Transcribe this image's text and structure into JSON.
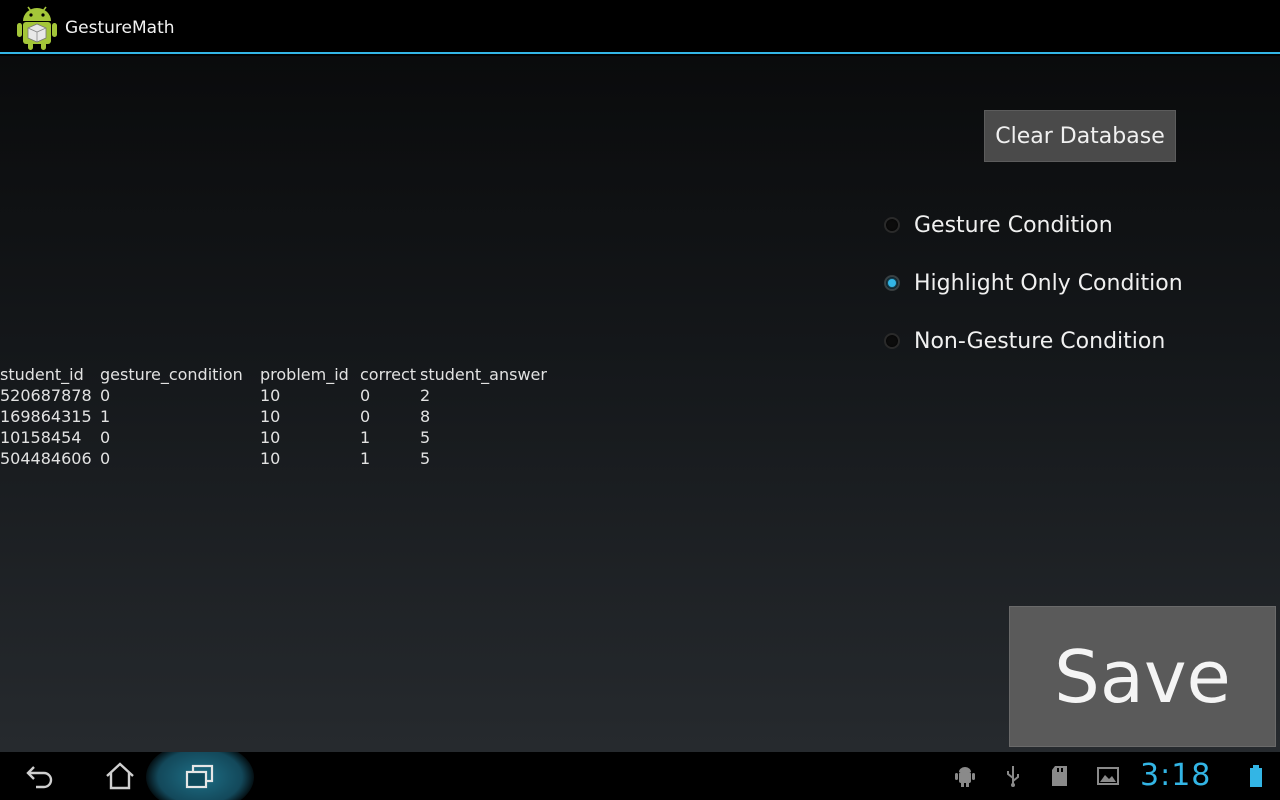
{
  "app": {
    "title": "GestureMath"
  },
  "buttons": {
    "clear_database": "Clear Database",
    "save": "Save"
  },
  "conditions": [
    {
      "label": "Gesture Condition",
      "checked": false
    },
    {
      "label": "Highlight Only Condition",
      "checked": true
    },
    {
      "label": "Non-Gesture Condition",
      "checked": false
    }
  ],
  "table": {
    "headers": [
      "student_id",
      "gesture_condition",
      "problem_id",
      "correct",
      "student_answer"
    ],
    "rows": [
      [
        "520687878",
        "0",
        "10",
        "0",
        "2"
      ],
      [
        "169864315",
        "1",
        "10",
        "0",
        "8"
      ],
      [
        "10158454",
        "0",
        "10",
        "1",
        "5"
      ],
      [
        "504484606",
        "0",
        "10",
        "1",
        "5"
      ]
    ]
  },
  "system_bar": {
    "time": "3:18",
    "accent_color": "#33b5e5",
    "nav_icons": [
      "back-icon",
      "home-icon",
      "recents-icon"
    ],
    "status_icons": [
      "android-debug-icon",
      "usb-icon",
      "sd-card-icon",
      "gallery-icon",
      "battery-icon"
    ]
  }
}
